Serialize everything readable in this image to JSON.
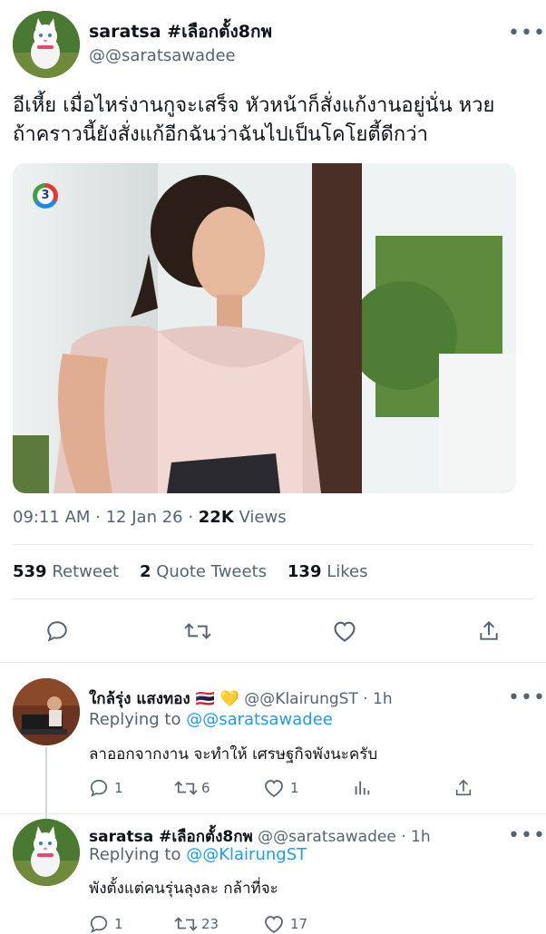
{
  "main_tweet": {
    "author_name": "saratsa #เลือกตั้ง8กพ",
    "author_handle": "@@saratsawadee",
    "text_line1": "อีเหี้ย เมื่อไหร่งานกูจะเสร็จ หัวหน้าก็สั่งแก้งานอยู่นั่น หวย",
    "text_line2": "ถ้าคราวนี้ยังสั่งแก้อีกฉันว่าฉันไปเป็นโคโยตี้ดีกว่า",
    "media_channel_badge": "3",
    "time": "09:11 AM · 12 Jan 26 ·",
    "views_count": "22K",
    "views_label": "Views",
    "retweets_count": "539",
    "retweets_label": "Retweet",
    "quotes_count": "2",
    "quotes_label": "Quote Tweets",
    "likes_count": "139",
    "likes_label": "Likes"
  },
  "replies": [
    {
      "author_name": "ใกล้รุ่ง แสงทอง 🇹🇭 💛",
      "author_handle": "@@KlairungST · 1h",
      "replying_label": "Replying to",
      "replying_to": "@@saratsawadee",
      "text": "ลาออกจากงาน จะทำให้ เศรษฐกิจพังนะครับ",
      "reply_count": "1",
      "retweet_count": "6",
      "like_count": "1"
    },
    {
      "author_name": "saratsa #เลือกตั้ง8กพ",
      "author_handle": "@@saratsawadee · 1h",
      "replying_label": "Replying to",
      "replying_to": "@@KlairungST",
      "text": "พังตั้งแต่คนรุ่นลุงละ กล้าที่จะ",
      "reply_count": "1",
      "retweet_count": "23",
      "like_count": "17"
    }
  ],
  "more_label": "•••",
  "colors": {
    "accent": "#1d9bf0",
    "muted": "#536471",
    "text": "#0f1419"
  },
  "icons": [
    "reply-icon",
    "retweet-icon",
    "like-icon",
    "share-icon",
    "analytics-icon",
    "more-icon"
  ]
}
